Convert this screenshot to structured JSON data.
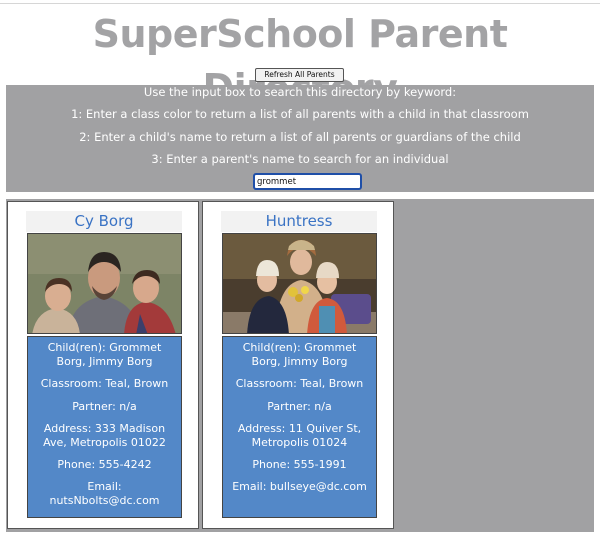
{
  "header": {
    "title": "SuperSchool Parent Directory",
    "refresh_label": "Refresh All Parents"
  },
  "search": {
    "instructions": [
      "Use the input box to search this directory by keyword:",
      "1: Enter a class color to return a list of all parents with a child in that classroom",
      "2: Enter a child's name to return a list of all parents or guardians of the child",
      "3: Enter a parent's name to search for an individual"
    ],
    "value": "grommet"
  },
  "results": [
    {
      "name": "Cy Borg",
      "children": "Child(ren): Grommet Borg, Jimmy Borg",
      "classroom": "Classroom: Teal, Brown",
      "partner": "Partner: n/a",
      "address": "Address: 333 Madison Ave, Metropolis 01022",
      "phone": "Phone: 555-4242",
      "email": "Email: nutsNbolts@dc.com"
    },
    {
      "name": "Huntress",
      "children": "Child(ren): Grommet Borg, Jimmy Borg",
      "classroom": "Classroom: Teal, Brown",
      "partner": "Partner: n/a",
      "address": "Address: 11 Quiver St, Metropolis 01024",
      "phone": "Phone: 555-1991",
      "email": "Email: bullseye@dc.com"
    }
  ],
  "colors": {
    "title": "#a3a3a5",
    "panel": "#a1a1a3",
    "name_text": "#3a73c4",
    "info_bg": "#5388c8"
  }
}
